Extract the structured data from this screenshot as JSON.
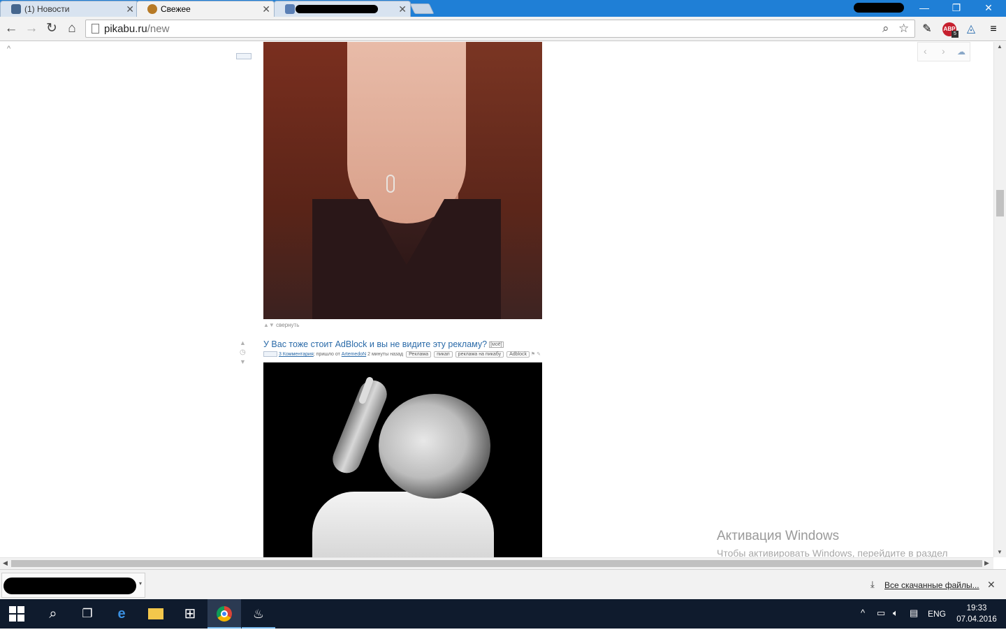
{
  "browser": {
    "tabs": [
      {
        "label": "(1) Новости",
        "favicon_color": "#45668e"
      },
      {
        "label": "Свежее",
        "favicon_color": "#b77a26"
      },
      {
        "label": "",
        "favicon_color": "#5a7fb5"
      }
    ],
    "window_controls": {
      "minimize": "—",
      "restore": "❐",
      "close": "✕"
    },
    "url_host": "pikabu.ru",
    "url_path": "/new",
    "extensions": {
      "abp_label": "ABP",
      "abp_count": "5"
    }
  },
  "page": {
    "sidebar_collapse": "^",
    "post1": {
      "collapse_label": "свернуть"
    },
    "post2": {
      "title": "У Вас тоже стоит AdBlock и вы не видите эту рекламу?",
      "my_tag": "[моё]",
      "comments_link": "3 Комментария",
      "posted_by": "; пришло от",
      "author": "ArtemedoN",
      "time": "2 минуты назад",
      "tags": [
        "Реклама",
        "пикап",
        "реклама на пикабу",
        "Adblock"
      ]
    },
    "nav_widget": {
      "prev": "‹",
      "next": "›"
    }
  },
  "watermark": {
    "title": "Активация Windows",
    "subtitle": "Чтобы активировать Windows, перейдите в раздел \"Параметры\"."
  },
  "downloads": {
    "show_all": "Все скачанные файлы...",
    "close": "✕"
  },
  "taskbar": {
    "language": "ENG",
    "time": "19:33",
    "date": "07.04.2016"
  },
  "colors": {
    "titlebar": "#1f7fd6",
    "link": "#2a6aa8",
    "taskbar": "#0f1b2d"
  }
}
